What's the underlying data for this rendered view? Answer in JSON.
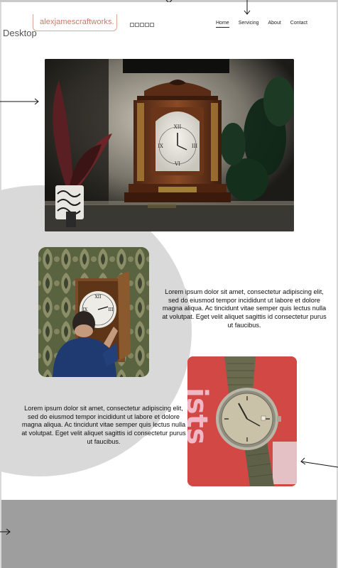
{
  "canvas": {
    "frame_label": "Desktop"
  },
  "header": {
    "logo_text": "alexjamescraftworks.",
    "nav": [
      {
        "label": "Home",
        "active": true
      },
      {
        "label": "Servicing",
        "active": false
      },
      {
        "label": "About",
        "active": false
      },
      {
        "label": "Contact",
        "active": false
      }
    ]
  },
  "main": {
    "hero_image": "mantel-bracket-clock-photo",
    "section_1": {
      "image": "clockmaker-repairing-clock-photo",
      "text": "Lorem ipsum dolor sit amet, consectetur adipiscing elit, sed do eiusmod tempor incididunt ut labore et dolore magna aliqua. Ac tincidunt vitae semper quis lectus nulla at volutpat. Eget velit aliquet sagittis id consectetur purus ut faucibus."
    },
    "section_2": {
      "image": "vintage-wristwatch-photo",
      "text": "Lorem ipsum dolor sit amet, consectetur adipiscing elit, sed do eiusmod tempor incididunt ut labore et dolore magna aliqua. Ac tincidunt vitae semper quis lectus nulla at volutpat. Eget velit aliquet sagittis id consectetur purus ut faucibus."
    }
  },
  "colors": {
    "logo": "#c87967",
    "background_circle": "#d9d9d9",
    "footer": "#9e9e9e"
  }
}
